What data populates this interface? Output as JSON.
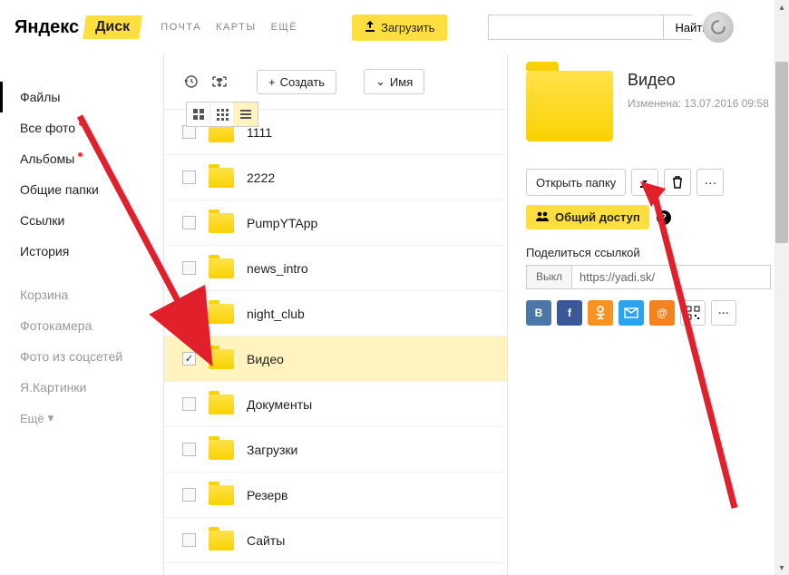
{
  "header": {
    "logo": "Яндекс",
    "disk": "Диск",
    "nav": [
      "Почта",
      "Карты",
      "Ещё"
    ],
    "upload": "Загрузить",
    "search_btn": "Найти"
  },
  "sidebar": {
    "primary": [
      {
        "label": "Файлы",
        "active": true,
        "dot": false
      },
      {
        "label": "Все фото",
        "active": false,
        "dot": true
      },
      {
        "label": "Альбомы",
        "active": false,
        "dot": true
      },
      {
        "label": "Общие папки",
        "active": false,
        "dot": false
      },
      {
        "label": "Ссылки",
        "active": false,
        "dot": false
      },
      {
        "label": "История",
        "active": false,
        "dot": false
      }
    ],
    "secondary": [
      {
        "label": "Корзина"
      },
      {
        "label": "Фотокамера"
      },
      {
        "label": "Фото из соцсетей"
      },
      {
        "label": "Я.Картинки"
      }
    ],
    "more": "Ещё"
  },
  "toolbar": {
    "create": "Создать",
    "sort": "Имя"
  },
  "files": [
    {
      "name": "1111",
      "selected": false
    },
    {
      "name": "2222",
      "selected": false
    },
    {
      "name": "PumpYTApp",
      "selected": false
    },
    {
      "name": "news_intro",
      "selected": false
    },
    {
      "name": "night_club",
      "selected": false
    },
    {
      "name": "Видео",
      "selected": true
    },
    {
      "name": "Документы",
      "selected": false
    },
    {
      "name": "Загрузки",
      "selected": false
    },
    {
      "name": "Резерв",
      "selected": false
    },
    {
      "name": "Сайты",
      "selected": false
    }
  ],
  "details": {
    "title": "Видео",
    "meta": "Изменена: 13.07.2016 09:58",
    "open": "Открыть папку",
    "share": "Общий доступ",
    "link_label": "Поделиться ссылкой",
    "link_toggle": "Выкл",
    "link_value": "https://yadi.sk/"
  }
}
